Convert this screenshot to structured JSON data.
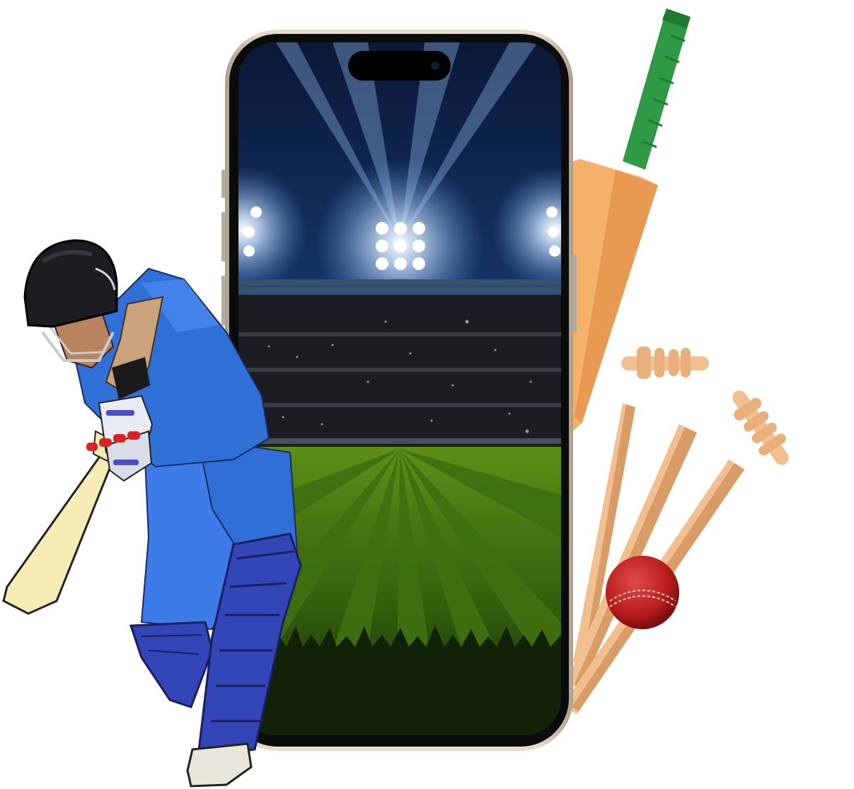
{
  "scene": {
    "background_color": "#ffffff",
    "colors": {
      "phone_frame": "#d6cab6",
      "phone_bezel": "#0b0b0c",
      "sky_top": "#0c1b3c",
      "sky_glow": "#9cc9ff",
      "stands": "#1b1d22",
      "grass_light": "#5c8f16",
      "grass_dark": "#2f5a0c",
      "jersey": "#2f6fd6",
      "trousers": "#3d7be8",
      "pads": "#3346b8",
      "helmet": "#1b1d20",
      "willow": "#f5b06a",
      "grip": "#2e9a45",
      "stumps": "#f2c090",
      "ball": "#c32121"
    },
    "icons": [
      "phone-icon",
      "floodlight-icon",
      "cricket-bat-icon",
      "stumps-icon",
      "bails-icon",
      "cricket-ball-icon",
      "batsman-icon"
    ]
  }
}
